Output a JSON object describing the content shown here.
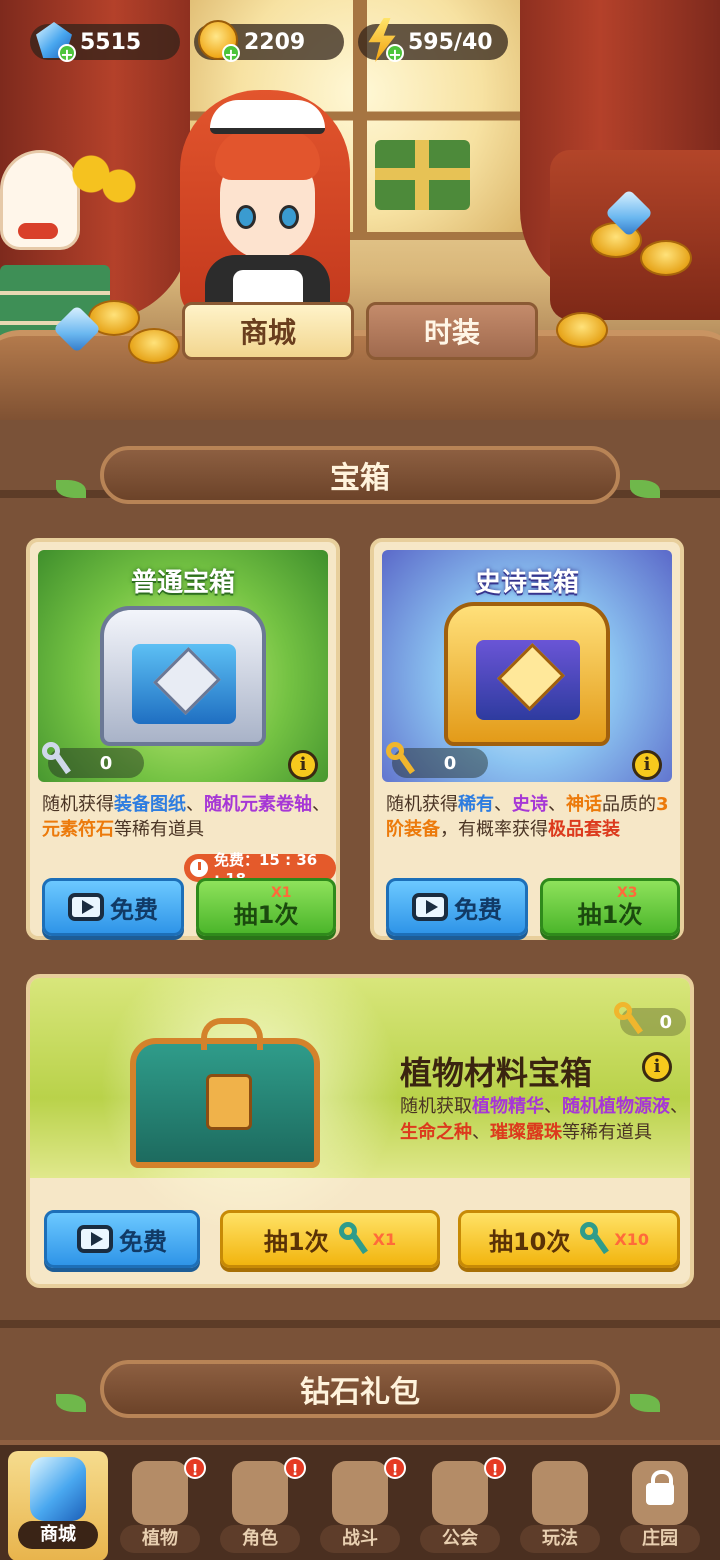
{
  "resources": {
    "diamonds": "5515",
    "coins": "2209",
    "energy": "595/40"
  },
  "shop_tabs": {
    "shop": "商城",
    "outfit": "时装"
  },
  "sections": {
    "chests": "宝箱",
    "diamond_pack": "钻石礼包"
  },
  "common_chest": {
    "title": "普通宝箱",
    "key_count": "0",
    "desc_parts": [
      "随机获得",
      "装备图纸",
      "、",
      "随机元素卷轴",
      "、",
      "元素符石",
      "等稀有道具"
    ],
    "timer": "免费：15 : 36 : 18",
    "free_label": "免费",
    "draw_label": "抽1次",
    "draw_mult": "X1"
  },
  "epic_chest": {
    "title": "史诗宝箱",
    "key_count": "0",
    "desc_parts": [
      "随机获得",
      "稀有",
      "、",
      "史诗",
      "、",
      "神话",
      "品质的",
      "3阶装备",
      "，有概率获得",
      "极品套装"
    ],
    "free_label": "免费",
    "draw_label": "抽1次",
    "draw_mult": "X3"
  },
  "plant_chest": {
    "title": "植物材料宝箱",
    "key_count": "0",
    "desc_parts": [
      "随机获取",
      "植物精华",
      "、",
      "随机植物源液",
      "、",
      "生命之种",
      "、",
      "璀璨露珠",
      "等稀有道具"
    ],
    "free_label": "免费",
    "draw1_label": "抽1次",
    "draw1_mult": "X1",
    "draw10_label": "抽10次",
    "draw10_mult": "X10"
  },
  "nav": [
    {
      "label": "商城",
      "badge": ""
    },
    {
      "label": "植物",
      "badge": "!"
    },
    {
      "label": "角色",
      "badge": "!"
    },
    {
      "label": "战斗",
      "badge": "!"
    },
    {
      "label": "公会",
      "badge": "!"
    },
    {
      "label": "玩法",
      "badge": ""
    },
    {
      "label": "庄园",
      "badge": ""
    }
  ],
  "colors": {
    "wood_dark": "#6e4a33",
    "card_bg": "#f6e7c7",
    "btn_blue": "#2f95e8",
    "btn_green": "#4cb62b",
    "btn_yellow": "#f2b50f",
    "badge_red": "#e53b24"
  }
}
